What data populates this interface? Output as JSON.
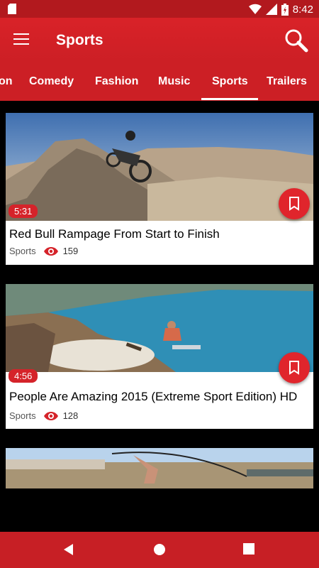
{
  "status": {
    "time": "8:42"
  },
  "appbar": {
    "title": "Sports"
  },
  "tabs": [
    "on",
    "Comedy",
    "Fashion",
    "Music",
    "Sports",
    "Trailers"
  ],
  "selected_tab": "Sports",
  "videos": [
    {
      "title": "Red Bull Rampage From Start to Finish",
      "duration": "5:31",
      "category": "Sports",
      "views": "159"
    },
    {
      "title": "People Are Amazing 2015 (Extreme Sport Edition) HD",
      "duration": "4:56",
      "category": "Sports",
      "views": "128"
    }
  ],
  "colors": {
    "primary": "#cc1f25",
    "accent": "#e0252c"
  },
  "icons": {
    "menu": "menu-icon",
    "search": "search-icon",
    "bookmark": "bookmark-icon",
    "views": "eye-icon",
    "back": "back-icon",
    "home": "home-icon",
    "recents": "recents-icon"
  }
}
